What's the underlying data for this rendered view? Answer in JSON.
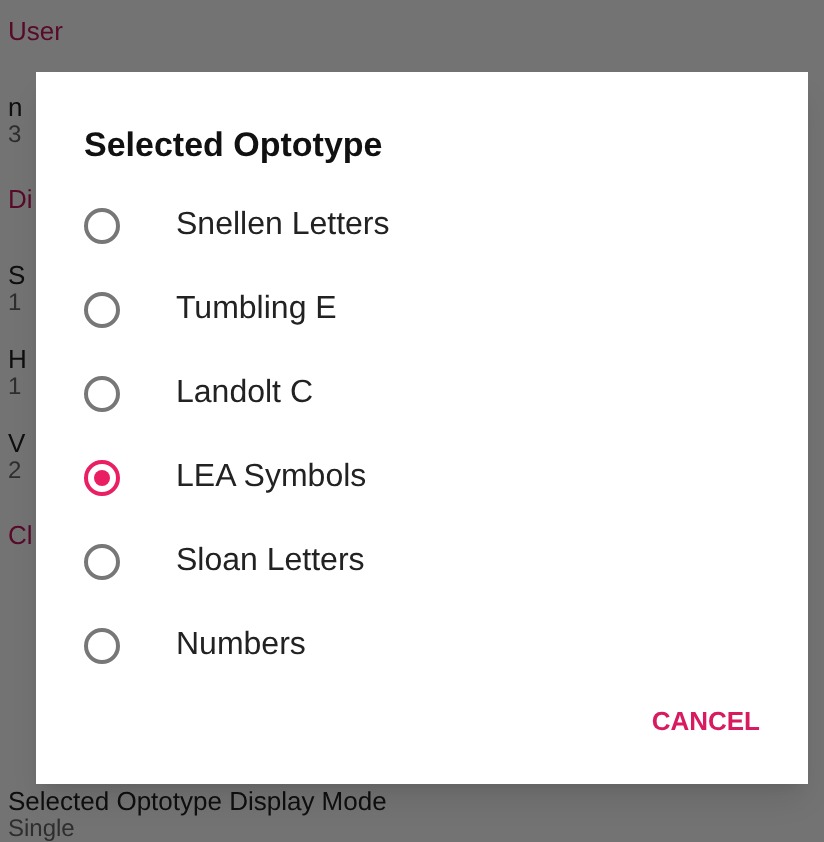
{
  "background": [
    {
      "kind": "header",
      "text": "User"
    },
    {
      "kind": "setting",
      "title": "n",
      "value": "3"
    },
    {
      "kind": "header",
      "text": "Di"
    },
    {
      "kind": "setting",
      "title": "S",
      "value": "1"
    },
    {
      "kind": "setting",
      "title": "H",
      "value": "1"
    },
    {
      "kind": "setting",
      "title": "V",
      "value": "2"
    },
    {
      "kind": "header",
      "text": "Cl"
    },
    {
      "kind": "setting",
      "title": "Selected Optotype Display Mode",
      "value": "Single"
    }
  ],
  "dialog": {
    "title": "Selected Optotype",
    "options": [
      {
        "label": "Snellen Letters",
        "selected": false
      },
      {
        "label": "Tumbling E",
        "selected": false
      },
      {
        "label": "Landolt C",
        "selected": false
      },
      {
        "label": "LEA Symbols",
        "selected": true
      },
      {
        "label": "Sloan Letters",
        "selected": false
      },
      {
        "label": "Numbers",
        "selected": false
      }
    ],
    "cancel": "CANCEL"
  }
}
